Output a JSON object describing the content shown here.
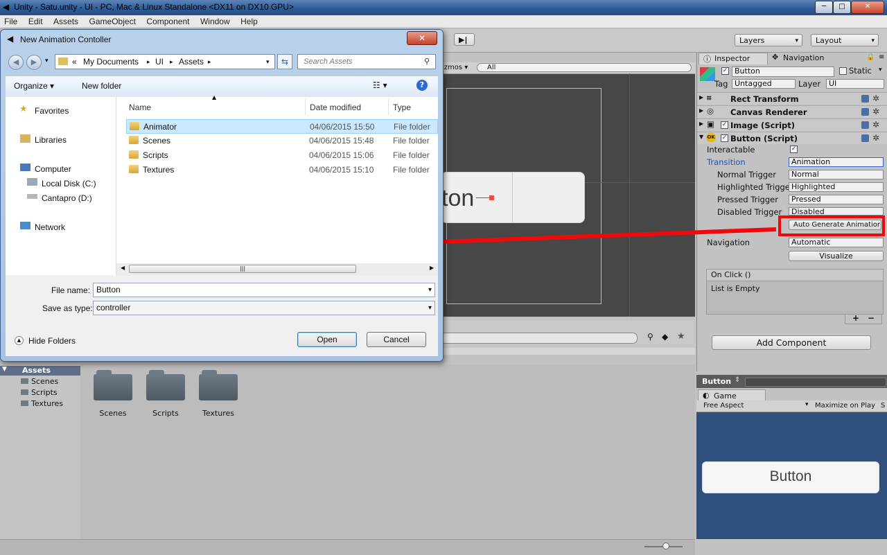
{
  "window": {
    "title": "Unity - Satu.unity - UI - PC, Mac & Linux Standalone <DX11 on DX10 GPU>",
    "minimize": "─",
    "maximize": "□",
    "close": "✕"
  },
  "menu": [
    "File",
    "Edit",
    "Assets",
    "GameObject",
    "Component",
    "Window",
    "Help"
  ],
  "toolbar": {
    "layers": "Layers",
    "layout": "Layout",
    "step": "▶|"
  },
  "scene": {
    "gizmos": "izmos ▾",
    "search": "All",
    "button_text": "ton"
  },
  "project": {
    "tree": [
      "Assets",
      "Scenes",
      "Scripts",
      "Textures"
    ],
    "folders": [
      "Scenes",
      "Scripts",
      "Textures"
    ]
  },
  "inspector": {
    "tab": "Inspector",
    "tab2": "Navigation",
    "object_name": "Button",
    "static": "Static",
    "tag_label": "Tag",
    "tag": "Untagged",
    "layer_label": "Layer",
    "layer": "UI",
    "components": [
      "Rect Transform",
      "Canvas Renderer",
      "Image (Script)",
      "Button (Script)"
    ],
    "interactable": "Interactable",
    "transition_label": "Transition",
    "transition": "Animation",
    "triggers": [
      {
        "label": "Normal Trigger",
        "value": "Normal"
      },
      {
        "label": "Highlighted Trigge",
        "value": "Highlighted"
      },
      {
        "label": "Pressed Trigger",
        "value": "Pressed"
      },
      {
        "label": "Disabled Trigger",
        "value": "Disabled"
      }
    ],
    "auto_generate": "Auto Generate Animatior",
    "navigation_label": "Navigation",
    "navigation": "Automatic",
    "visualize": "Visualize",
    "onclick": "On Click ()",
    "list_empty": "List is Empty",
    "plus": "+",
    "minus": "−",
    "add_component": "Add Component"
  },
  "game": {
    "header": "Button",
    "tab": "Game",
    "aspect": "Free Aspect",
    "maximize": "Maximize on Play",
    "maximize_trail": "S",
    "button": "Button"
  },
  "dialog": {
    "title": "New Animation Contoller",
    "breadcrumb": [
      "My Documents",
      "UI",
      "Assets"
    ],
    "search_placeholder": "Search Assets",
    "organize": "Organize",
    "new_folder": "New folder",
    "nav": {
      "favorites": "Favorites",
      "libraries": "Libraries",
      "computer": "Computer",
      "local_disk": "Local Disk (C:)",
      "cantapro": "Cantapro (D:)",
      "network": "Network"
    },
    "columns": [
      "Name",
      "Date modified",
      "Type"
    ],
    "files": [
      {
        "name": "Animator",
        "date": "04/06/2015 15:50",
        "type": "File folder"
      },
      {
        "name": "Scenes",
        "date": "04/06/2015 15:48",
        "type": "File folder"
      },
      {
        "name": "Scripts",
        "date": "04/06/2015 15:06",
        "type": "File folder"
      },
      {
        "name": "Textures",
        "date": "04/06/2015 15:10",
        "type": "File folder"
      }
    ],
    "file_name_label": "File name:",
    "file_name": "Button",
    "save_type_label": "Save as type:",
    "save_type": "controller",
    "hide_folders": "Hide Folders",
    "open": "Open",
    "cancel": "Cancel"
  },
  "colors": {
    "arrow": "#ee0a0a",
    "selection": "#cce8ff"
  }
}
